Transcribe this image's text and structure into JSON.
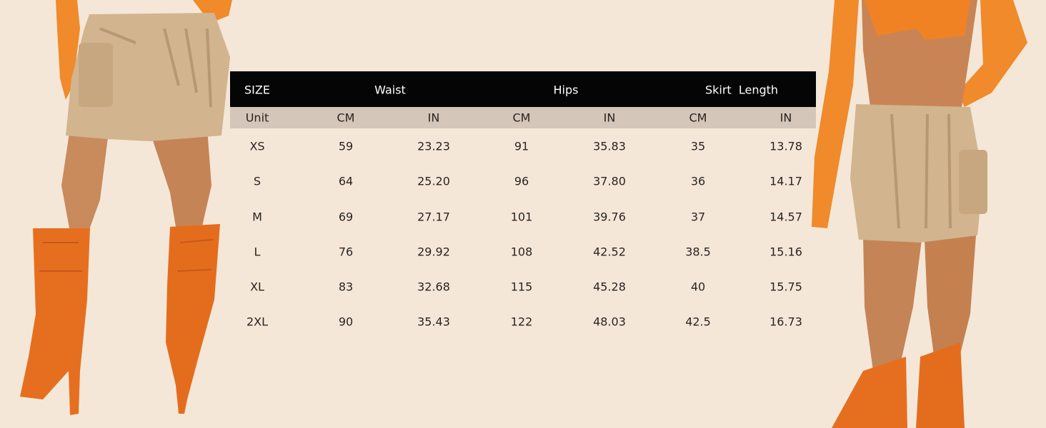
{
  "size_chart": {
    "header": {
      "size": "SIZE",
      "waist": "Waist",
      "hips": "Hips",
      "skirt_length": "Skirt  Length"
    },
    "units": [
      "Unit",
      "CM",
      "IN",
      "CM",
      "IN",
      "CM",
      "IN"
    ],
    "rows": [
      [
        "XS",
        "59",
        "23.23",
        "91",
        "35.83",
        "35",
        "13.78"
      ],
      [
        "S",
        "64",
        "25.20",
        "96",
        "37.80",
        "36",
        "14.17"
      ],
      [
        "M",
        "69",
        "27.17",
        "101",
        "39.76",
        "37",
        "14.57"
      ],
      [
        "L",
        "76",
        "29.92",
        "108",
        "42.52",
        "38.5",
        "15.16"
      ],
      [
        "XL",
        "83",
        "32.68",
        "115",
        "45.28",
        "40",
        "15.75"
      ],
      [
        "2XL",
        "90",
        "35.43",
        "122",
        "48.03",
        "42.5",
        "16.73"
      ]
    ]
  },
  "colors": {
    "background": "#f4e7d8",
    "header": "#050505",
    "unit_row": "#d4c6b8",
    "skirt": "#d2b48f",
    "boots": "#e66f1f"
  }
}
